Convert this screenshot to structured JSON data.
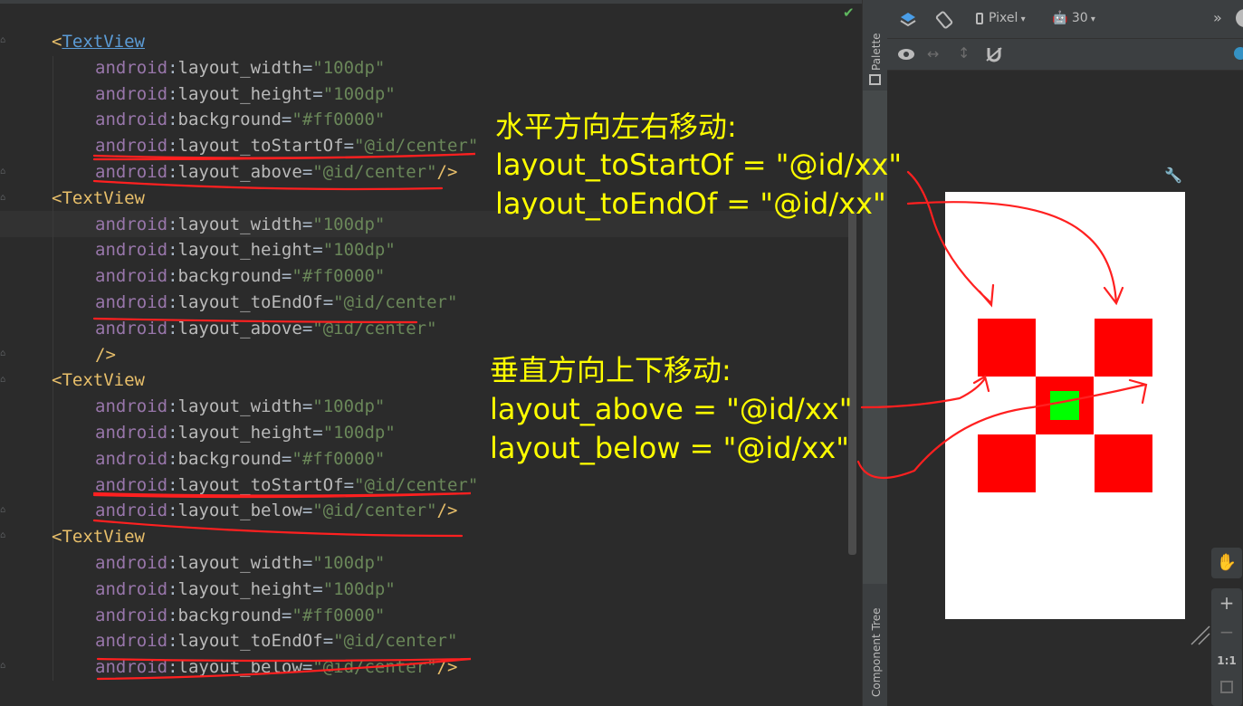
{
  "editor": {
    "lines": [
      {
        "indent": 0,
        "tag": "TextView",
        "link": true
      },
      {
        "indent": 1,
        "attr": "layout_width",
        "value": "\"100dp\""
      },
      {
        "indent": 1,
        "attr": "layout_height",
        "value": "\"100dp\""
      },
      {
        "indent": 1,
        "attr": "background",
        "value": "\"#ff0000\""
      },
      {
        "indent": 1,
        "attr": "layout_toStartOf",
        "value": "\"@id/center\""
      },
      {
        "indent": 1,
        "attr": "layout_above",
        "value": "\"@id/center\"",
        "close": "/>"
      },
      {
        "indent": 0,
        "tag": "TextView"
      },
      {
        "indent": 1,
        "attr": "layout_width",
        "value": "\"100dp\""
      },
      {
        "indent": 1,
        "attr": "layout_height",
        "value": "\"100dp\""
      },
      {
        "indent": 1,
        "attr": "background",
        "value": "\"#ff0000\""
      },
      {
        "indent": 1,
        "attr": "layout_toEndOf",
        "value": "\"@id/center\""
      },
      {
        "indent": 1,
        "attr": "layout_above",
        "value": "\"@id/center\""
      },
      {
        "indent": 1,
        "closeOnly": "/>"
      },
      {
        "indent": 0,
        "tag": "TextView"
      },
      {
        "indent": 1,
        "attr": "layout_width",
        "value": "\"100dp\""
      },
      {
        "indent": 1,
        "attr": "layout_height",
        "value": "\"100dp\""
      },
      {
        "indent": 1,
        "attr": "background",
        "value": "\"#ff0000\""
      },
      {
        "indent": 1,
        "attr": "layout_toStartOf",
        "value": "\"@id/center\""
      },
      {
        "indent": 1,
        "attr": "layout_below",
        "value": "\"@id/center\"",
        "close": "/>"
      },
      {
        "indent": 0,
        "tag": "TextView"
      },
      {
        "indent": 1,
        "attr": "layout_width",
        "value": "\"100dp\""
      },
      {
        "indent": 1,
        "attr": "layout_height",
        "value": "\"100dp\""
      },
      {
        "indent": 1,
        "attr": "background",
        "value": "\"#ff0000\""
      },
      {
        "indent": 1,
        "attr": "layout_toEndOf",
        "value": "\"@id/center\""
      },
      {
        "indent": 1,
        "attr": "layout_below",
        "value": "\"@id/center\"",
        "close": "/>"
      }
    ],
    "namespace": "android"
  },
  "tool_strip": {
    "palette_label": "Palette",
    "component_tree_label": "Component Tree"
  },
  "preview": {
    "device_label": "Pixel",
    "api_label": "30",
    "more_label": "»",
    "zoom_in": "+",
    "zoom_out": "−",
    "zoom_fit": "1:1",
    "colors": {
      "red": "#ff0000",
      "green": "#00ff00"
    }
  },
  "annotations": {
    "horizontal_title": "水平方向左右移动:",
    "horizontal_rule1": "layout_toStartOf = \"@id/xx\"",
    "horizontal_rule2": "layout_toEndOf = \"@id/xx\"",
    "vertical_title": "垂直方向上下移动:",
    "vertical_rule1": "layout_above = \"@id/xx\"",
    "vertical_rule2": "layout_below = \"@id/xx\""
  }
}
